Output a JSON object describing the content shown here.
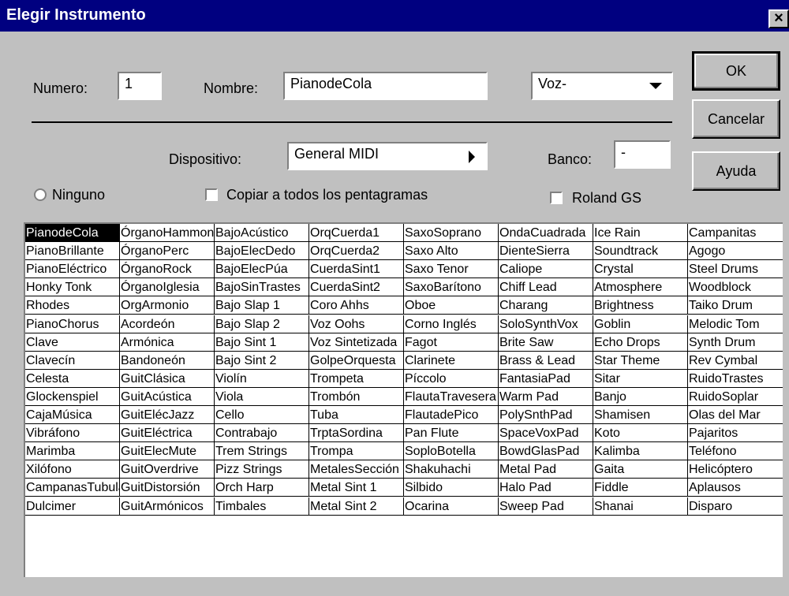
{
  "window": {
    "title": "Elegir Instrumento",
    "close_glyph": "×"
  },
  "numero": {
    "label": "Numero:",
    "value": "1"
  },
  "nombre": {
    "label": "Nombre:",
    "value": "PianodeCola"
  },
  "voz": {
    "value": "Voz-"
  },
  "dispositivo": {
    "label": "Dispositivo:",
    "value": "General MIDI"
  },
  "banco": {
    "label": "Banco:",
    "value": "-"
  },
  "ninguno": {
    "label": "Ninguno"
  },
  "copiar": {
    "label": "Copiar a todos los pentagramas"
  },
  "roland": {
    "label": "Roland GS"
  },
  "buttons": {
    "ok": "OK",
    "cancelar": "Cancelar",
    "ayuda": "Ayuda"
  },
  "instruments": [
    [
      "PianodeCola",
      "PianoBrillante",
      "PianoEléctrico",
      "Honky Tonk",
      "Rhodes",
      "PianoChorus",
      "Clave",
      "Clavecín",
      "Celesta",
      "Glockenspiel",
      "CajaMúsica",
      "Vibráfono",
      "Marimba",
      "Xilófono",
      "CampanasTubulares",
      "Dulcimer"
    ],
    [
      "ÓrganoHammond",
      "ÓrganoPerc",
      "ÓrganoRock",
      "ÓrganoIglesia",
      "OrgArmonio",
      "Acordeón",
      "Armónica",
      "Bandoneón",
      "GuitClásica",
      "GuitAcústica",
      "GuitElécJazz",
      "GuitEléctrica",
      "GuitElecMute",
      "GuitOverdrive",
      "GuitDistorsión",
      "GuitArmónicos"
    ],
    [
      "BajoAcústico",
      "BajoElecDedo",
      "BajoElecPúa",
      "BajoSinTrastes",
      "Bajo Slap  1",
      "Bajo Slap 2",
      "Bajo Sint 1",
      "Bajo Sint 2",
      "Violín",
      "Viola",
      "Cello",
      "Contrabajo",
      "Trem Strings",
      "Pizz Strings",
      "Orch Harp",
      "Timbales"
    ],
    [
      "OrqCuerda1",
      "OrqCuerda2",
      "CuerdaSint1",
      "CuerdaSint2",
      "Coro Ahhs",
      "Voz Oohs",
      "Voz Sintetizada",
      "GolpeOrquesta",
      "Trompeta",
      "Trombón",
      "Tuba",
      "TrptaSordina",
      "Trompa",
      "MetalesSección",
      "Metal Sint 1",
      "Metal Sint 2"
    ],
    [
      "SaxoSoprano",
      "Saxo Alto",
      "Saxo Tenor",
      "SaxoBarítono",
      "Oboe",
      "Corno Inglés",
      "Fagot",
      "Clarinete",
      "Píccolo",
      "FlautaTravesera",
      "FlautadePico",
      "Pan Flute",
      "SoploBotella",
      "Shakuhachi",
      "Silbido",
      "Ocarina"
    ],
    [
      "OndaCuadrada",
      "DienteSierra",
      "Caliope",
      "Chiff Lead",
      "Charang",
      "SoloSynthVox",
      "Brite Saw",
      "Brass & Lead",
      "FantasiaPad",
      "Warm Pad",
      "PolySnthPad",
      "SpaceVoxPad",
      "BowdGlasPad",
      "Metal Pad",
      "Halo Pad",
      "Sweep Pad"
    ],
    [
      "Ice Rain",
      "Soundtrack",
      "Crystal",
      "Atmosphere",
      "Brightness",
      "Goblin",
      "Echo Drops",
      "Star Theme",
      "Sitar",
      "Banjo",
      "Shamisen",
      "Koto",
      "Kalimba",
      "Gaita",
      "Fiddle",
      "Shanai"
    ],
    [
      "Campanitas",
      "Agogo",
      "Steel Drums",
      "Woodblock",
      "Taiko Drum",
      "Melodic Tom",
      "Synth Drum",
      "Rev Cymbal",
      "RuidoTrastes",
      "RuidoSoplar",
      "Olas del Mar",
      "Pajaritos",
      "Teléfono",
      "Helicóptero",
      "Aplausos",
      "Disparo"
    ]
  ]
}
